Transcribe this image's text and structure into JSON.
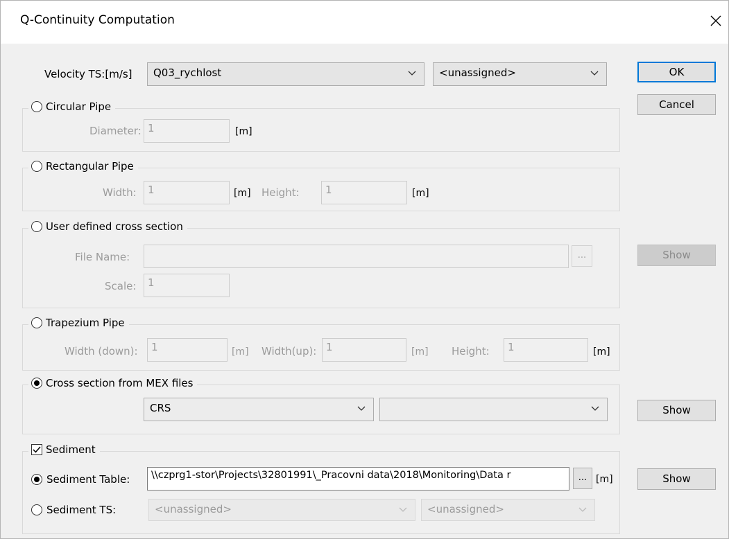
{
  "window": {
    "title": "Q-Continuity Computation",
    "close_icon": "close-icon"
  },
  "velocity": {
    "label": "Velocity TS:[m/s]",
    "ts_value": "Q03_rychlost",
    "second_value": "<unassigned>"
  },
  "buttons": {
    "ok": "OK",
    "cancel": "Cancel",
    "show": "Show"
  },
  "circular": {
    "label": "Circular Pipe",
    "selected": false,
    "diameter_label": "Diameter:",
    "diameter_value": "1",
    "unit": "[m]"
  },
  "rectangular": {
    "label": "Rectangular Pipe",
    "selected": false,
    "width_label": "Width:",
    "width_value": "1",
    "width_unit": "[m]",
    "height_label": "Height:",
    "height_value": "1",
    "height_unit": "[m]"
  },
  "user_defined": {
    "label": "User defined cross section",
    "selected": false,
    "file_label": "File Name:",
    "file_value": "",
    "browse": "...",
    "scale_label": "Scale:",
    "scale_value": "1"
  },
  "trapezium": {
    "label": "Trapezium Pipe",
    "selected": false,
    "width_down_label": "Width (down):",
    "width_down_value": "1",
    "width_down_unit": "[m]",
    "width_up_label": "Width(up):",
    "width_up_value": "1",
    "width_up_unit": "[m]",
    "height_label": "Height:",
    "height_value": "1",
    "height_unit": "[m]"
  },
  "mex": {
    "label": "Cross section from MEX files",
    "selected": true,
    "combo1": "CRS",
    "combo2": ""
  },
  "sediment": {
    "label": "Sediment",
    "checked": true,
    "table_label": "Sediment Table:",
    "table_selected": true,
    "table_path": "\\\\czprg1-stor\\Projects\\32801991\\_Pracovni data\\2018\\Monitoring\\Data r",
    "browse": "...",
    "unit": "[m]",
    "ts_label": "Sediment TS:",
    "ts_selected": false,
    "ts_value1": "<unassigned>",
    "ts_value2": "<unassigned>"
  }
}
